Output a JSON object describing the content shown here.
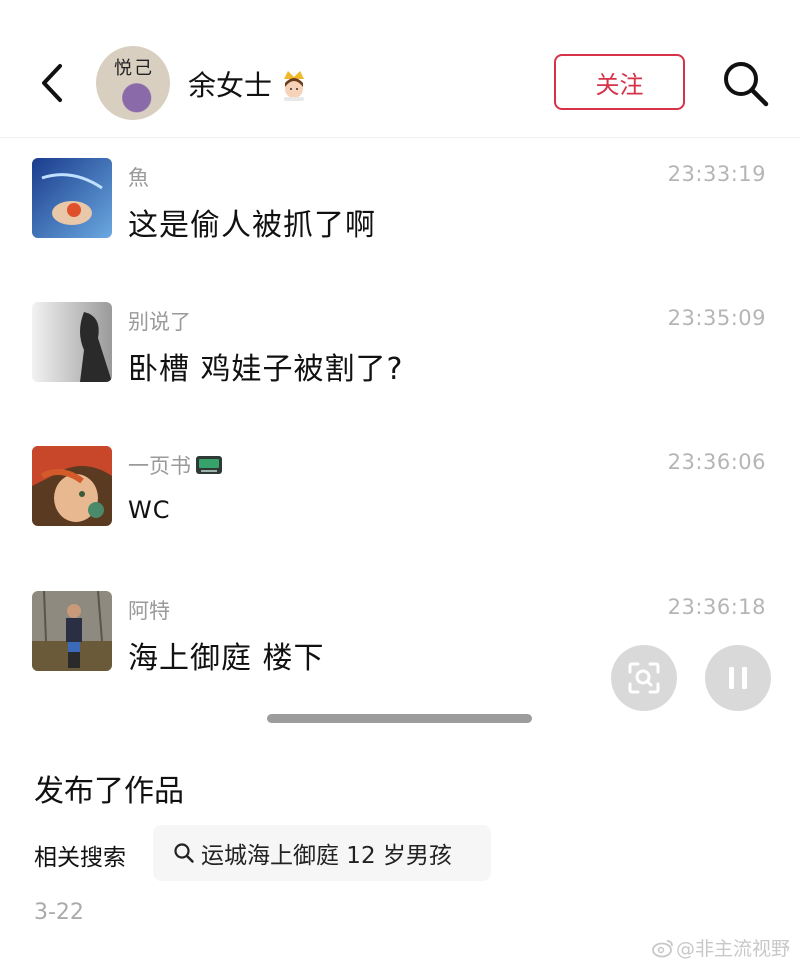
{
  "header": {
    "title": "余女士",
    "avatar_text": "悦己",
    "follow_label": "关注"
  },
  "comments": [
    {
      "name": "魚",
      "time": "23:33:19",
      "text": "这是偷人被抓了啊"
    },
    {
      "name": "别说了",
      "time": "23:35:09",
      "text": "卧槽 鸡娃子被割了?"
    },
    {
      "name": "一页书",
      "time": "23:36:06",
      "text": "WC"
    },
    {
      "name": "阿特",
      "time": "23:36:18",
      "text": "海上御庭 楼下"
    }
  ],
  "post": {
    "published_label": "发布了作品",
    "related_label": "相关搜索",
    "related_query": "运城海上御庭 12 岁男孩",
    "date": "3-22"
  },
  "watermark": "@非主流视野",
  "colors": {
    "accent": "#d6324a"
  },
  "icons": [
    "back-icon",
    "crown-emoji-icon",
    "search-icon",
    "keyboard-emoji-icon",
    "screenshot-search-icon",
    "pause-icon",
    "weibo-icon"
  ]
}
